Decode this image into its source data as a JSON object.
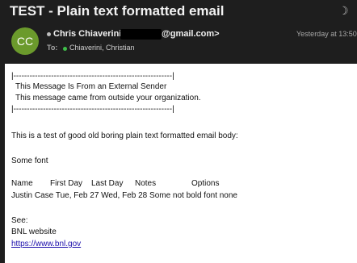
{
  "header": {
    "subject": "TEST - Plain text formatted email",
    "avatar_initials": "CC",
    "avatar_color": "#6b9a2c",
    "from_name": "Chris Chiaverini <",
    "from_domain": "@gmail.com>",
    "time": "Yesterday at 13:50",
    "to_label": "To:",
    "to_name": "Chiaverini, Christian",
    "theme_icon": "moon-icon"
  },
  "body": {
    "banner_top": "|-----------------------------------------------------------|",
    "banner_line1": "This Message Is From an External Sender",
    "banner_line2": "This message came from outside your organization.",
    "banner_bottom": "|-----------------------------------------------------------|",
    "intro": "This is a test of good old boring plain text formatted email body:",
    "some_font": "Some font",
    "table": {
      "headers": [
        "Name",
        "First Day",
        "Last Day",
        "Notes",
        "Options"
      ],
      "row": "Justin Case Tue, Feb 27 Wed, Feb 28 Some not bold font none"
    },
    "see_label": "See:",
    "link_label": "BNL website",
    "link_url": "https://www.bnl.gov"
  }
}
